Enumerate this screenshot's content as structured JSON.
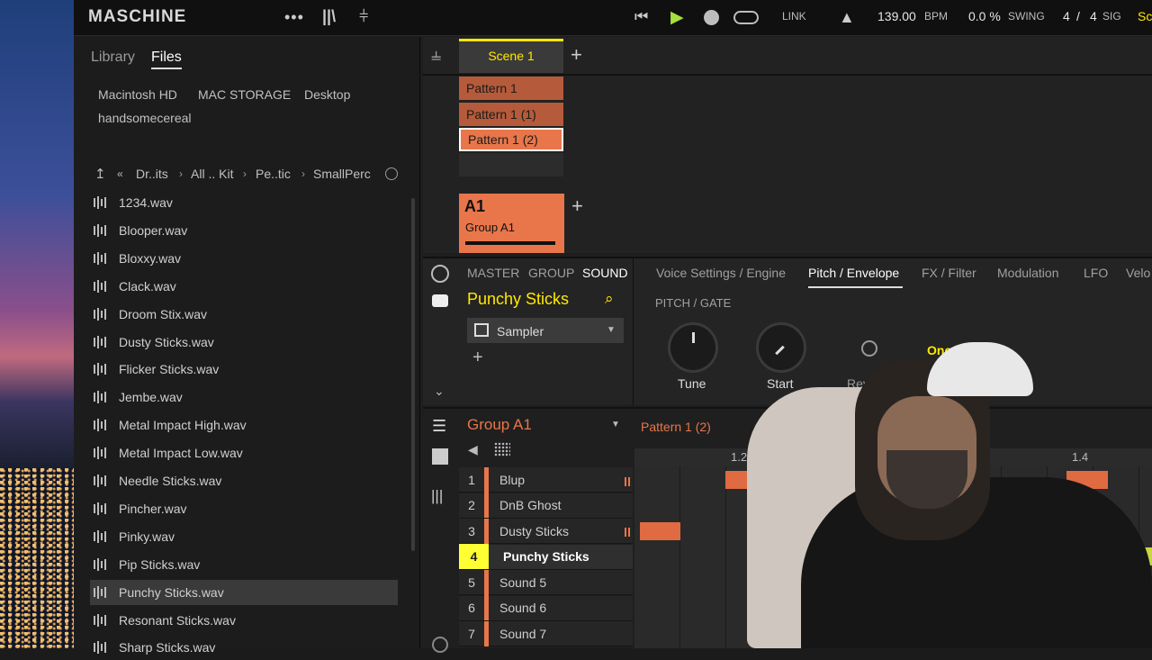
{
  "app": {
    "logo": "MASCHINE"
  },
  "transport": {
    "link": "LINK",
    "tempo": "139.00",
    "tempo_unit": "BPM",
    "swing": "0.0 %",
    "swing_label": "SWING",
    "sig_num": "4",
    "sig_sep": "/",
    "sig_den": "4",
    "sig_label": "SIG",
    "extra": "Sc"
  },
  "browser": {
    "tabs": [
      "Library",
      "Files"
    ],
    "locations": [
      "Macintosh HD",
      "MAC STORAGE",
      "Desktop",
      "handsomecereal"
    ],
    "breadcrumb": [
      "Dr..its",
      "All .. Kit",
      "Pe..tic",
      "SmallPerc"
    ],
    "files": [
      "1234.wav",
      "Blooper.wav",
      "Bloxxy.wav",
      "Clack.wav",
      "Droom Stix.wav",
      "Dusty Sticks.wav",
      "Flicker Sticks.wav",
      "Jembe.wav",
      "Metal Impact High.wav",
      "Metal Impact Low.wav",
      "Needle Sticks.wav",
      "Pincher.wav",
      "Pinky.wav",
      "Pip Sticks.wav",
      "Punchy Sticks.wav",
      "Resonant Sticks.wav",
      "Sharp Sticks.wav"
    ],
    "selected_index": 14
  },
  "arranger": {
    "scene": "Scene 1",
    "patterns": [
      "Pattern 1",
      "Pattern 1 (1)",
      "Pattern 1 (2)"
    ],
    "group_id": "A1",
    "group_name": "Group A1"
  },
  "editor": {
    "levels": [
      "MASTER",
      "GROUP",
      "SOUND"
    ],
    "sound_name": "Punchy Sticks",
    "plugin": "Sampler",
    "tabs": [
      "Voice Settings / Engine",
      "Pitch / Envelope",
      "FX / Filter",
      "Modulation",
      "LFO",
      "Velo"
    ],
    "section": "PITCH / GATE",
    "knobs": [
      "Tune",
      "Start"
    ],
    "partial": [
      "Reverse",
      "One"
    ]
  },
  "pattern": {
    "group": "Group A1",
    "pattern_name": "Pattern 1 (2)",
    "ruler": [
      "1.2",
      "1.4"
    ],
    "sounds": [
      {
        "n": "1",
        "name": "Blup"
      },
      {
        "n": "2",
        "name": "DnB Ghost"
      },
      {
        "n": "3",
        "name": "Dusty Sticks"
      },
      {
        "n": "4",
        "name": "Punchy Sticks"
      },
      {
        "n": "5",
        "name": "Sound 5"
      },
      {
        "n": "6",
        "name": "Sound 6"
      },
      {
        "n": "7",
        "name": "Sound 7"
      }
    ]
  },
  "colors": {
    "accent": "#ffe800",
    "group": "#e8764a",
    "play": "#a6e03a"
  },
  "icons": [
    "skip-back-icon",
    "play-icon",
    "record-icon",
    "loop-icon",
    "metronome-icon",
    "menu-dots-icon",
    "library-icon",
    "mixer-icon",
    "search-icon",
    "speaker-icon",
    "grid-icon",
    "power-icon"
  ]
}
